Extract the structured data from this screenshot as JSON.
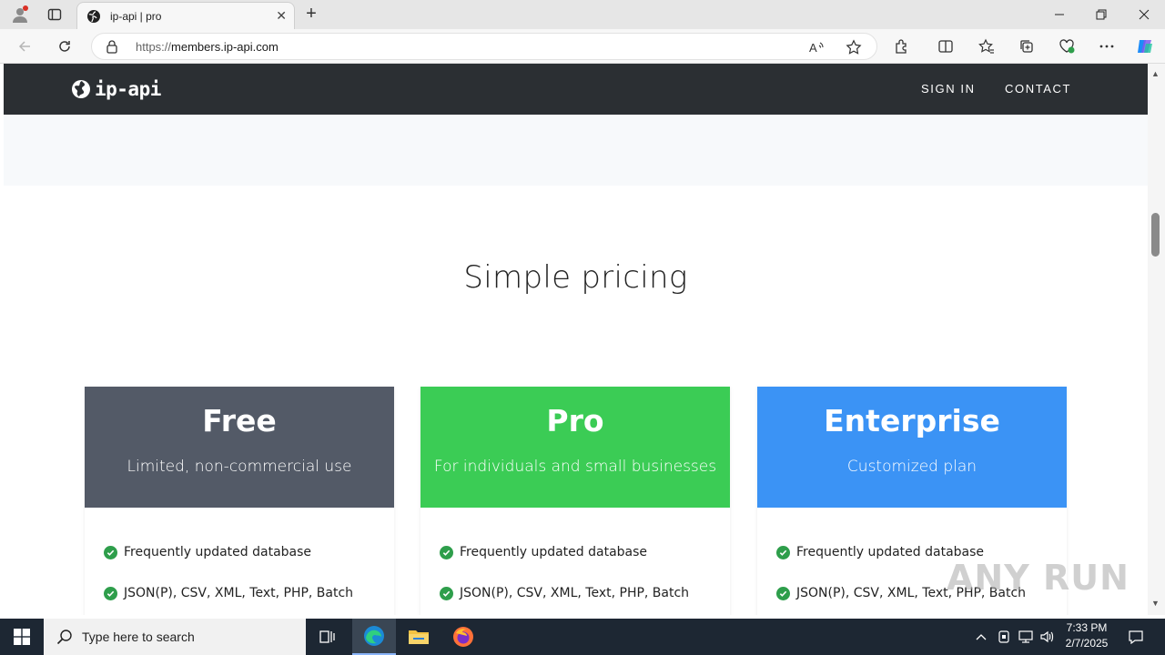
{
  "browser": {
    "tab_title": "ip-api | pro",
    "url_scheme": "https://",
    "url_host": "members.ip-api.com"
  },
  "site": {
    "logo_text": "ip-api",
    "nav": [
      {
        "label": "SIGN IN"
      },
      {
        "label": "CONTACT"
      }
    ],
    "section_title": "Simple pricing",
    "plans": [
      {
        "name": "Free",
        "description": "Limited, non-commercial use",
        "color": "#535a67",
        "features": [
          "Frequently updated database",
          "JSON(P), CSV, XML, Text, PHP, Batch"
        ]
      },
      {
        "name": "Pro",
        "description": "For individuals and small businesses",
        "color": "#3bcc55",
        "features": [
          "Frequently updated database",
          "JSON(P), CSV, XML, Text, PHP, Batch"
        ]
      },
      {
        "name": "Enterprise",
        "description": "Customized plan",
        "color": "#3b93f5",
        "features": [
          "Frequently updated database",
          "JSON(P), CSV, XML, Text, PHP, Batch"
        ]
      }
    ]
  },
  "taskbar": {
    "search_placeholder": "Type here to search",
    "time": "7:33 PM",
    "date": "2/7/2025"
  },
  "watermark": "ANY RUN"
}
